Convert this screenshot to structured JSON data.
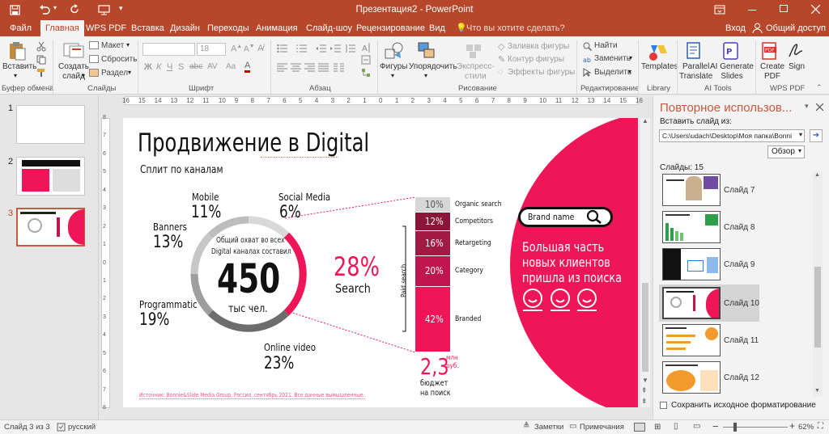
{
  "app": {
    "title": "Презентация2 - PowerPoint",
    "login": "Вход",
    "share": "Общий доступ"
  },
  "tabs": [
    "Файл",
    "Главная",
    "WPS PDF",
    "Вставка",
    "Дизайн",
    "Переходы",
    "Анимация",
    "Слайд-шоу",
    "Рецензирование",
    "Вид"
  ],
  "tell_me": "Что вы хотите сделать?",
  "ribbon": {
    "paste": "Вставить",
    "clipboard_group": "Буфер обмена",
    "new_slide_1": "Создать",
    "new_slide_2": "слайд",
    "layout": "Макет",
    "reset": "Сбросить",
    "section": "Раздел",
    "slides_group": "Слайды",
    "font_size": "18",
    "font_group": "Шрифт",
    "paragraph_group": "Абзац",
    "shapes": "Фигуры",
    "arrange": "Упорядочить",
    "quick_styles_1": "Экспресс-",
    "quick_styles_2": "стили",
    "shape_fill": "Заливка фигуры",
    "shape_outline": "Контур фигуры",
    "shape_effects": "Эффекты фигуры",
    "drawing_group": "Рисование",
    "find": "Найти",
    "replace": "Заменить",
    "select": "Выделить",
    "editing_group": "Редактирование",
    "templates": "Templates",
    "library_group": "Library",
    "parallel_1": "Parallel",
    "parallel_2": "Translate",
    "ai_gen_1": "AI Generate",
    "ai_gen_2": "Slides",
    "ai_group": "AI Tools",
    "create_pdf_1": "Create",
    "create_pdf_2": "PDF",
    "sign": "Sign",
    "wps_group": "WPS PDF"
  },
  "ruler": [
    "16",
    "15",
    "14",
    "13",
    "12",
    "11",
    "10",
    "9",
    "8",
    "7",
    "6",
    "5",
    "4",
    "3",
    "2",
    "1",
    "0",
    "1",
    "2",
    "3",
    "4",
    "5",
    "6",
    "7",
    "8",
    "9",
    "10",
    "11",
    "12",
    "13",
    "14",
    "15",
    "16"
  ],
  "vruler": [
    "8",
    "7",
    "6",
    "5",
    "4",
    "3",
    "2",
    "1",
    "0",
    "1",
    "2",
    "3",
    "4",
    "5",
    "6",
    "7",
    "8"
  ],
  "thumbnails": [
    "1",
    "2",
    "3"
  ],
  "slide": {
    "title": "Продвижение в Digital",
    "subtitle": "Сплит по каналам",
    "center_line1": "Общий охват во всех",
    "center_line2": "Digital каналах составил",
    "center_number": "450",
    "center_unit": "тыс чел.",
    "channels": [
      {
        "name": "Mobile",
        "value": "11%"
      },
      {
        "name": "Social Media",
        "value": "6%"
      },
      {
        "name": "Banners",
        "value": "13%"
      },
      {
        "name": "Programmatic",
        "value": "19%"
      },
      {
        "name": "Online video",
        "value": "23%"
      }
    ],
    "search_pct": "28%",
    "search_label": "Search",
    "stack": [
      {
        "value": "10%",
        "label": "Organic search",
        "color": "#d7d7d7"
      },
      {
        "value": "12%",
        "label": "Competitors",
        "color": "#8a1538"
      },
      {
        "value": "16%",
        "label": "Retargeting",
        "color": "#a11a44"
      },
      {
        "value": "20%",
        "label": "Category",
        "color": "#c0164f"
      },
      {
        "value": "42%",
        "label": "Branded",
        "color": "#ee1656"
      }
    ],
    "paid_search": "Paid search",
    "budget_number": "2,3",
    "budget_unit1": "млн",
    "budget_unit2": "руб.",
    "budget_label1": "бюджет",
    "budget_label2": "на поиск",
    "brand_name": "Brand name",
    "headline": [
      "Большая часть",
      "новых клиентов",
      "пришла из поиска"
    ],
    "source": "Источник: Bonnie&Slide Media Group, Россия, сентябрь 2021. Все данные вымышленные."
  },
  "reuse_panel": {
    "title": "Повторное использов...",
    "insert_from": "Вставить слайд из:",
    "path": "C:\\Users\\udach\\Desktop\\Моя папка\\Bonni",
    "browse": "Обзор",
    "slides_count": "Слайды: 15",
    "items": [
      {
        "label": "Слайд 7"
      },
      {
        "label": "Слайд 8"
      },
      {
        "label": "Слайд 9"
      },
      {
        "label": "Слайд 10"
      },
      {
        "label": "Слайд 11"
      },
      {
        "label": "Слайд 12"
      }
    ],
    "keep_format": "Сохранить исходное форматирование"
  },
  "status": {
    "slide_of": "Слайд 3 из 3",
    "language": "русский",
    "notes": "Заметки",
    "comments": "Примечания",
    "zoom": "62%"
  },
  "colors": {
    "accent": "#b7472a",
    "pink": "#ee1656"
  }
}
